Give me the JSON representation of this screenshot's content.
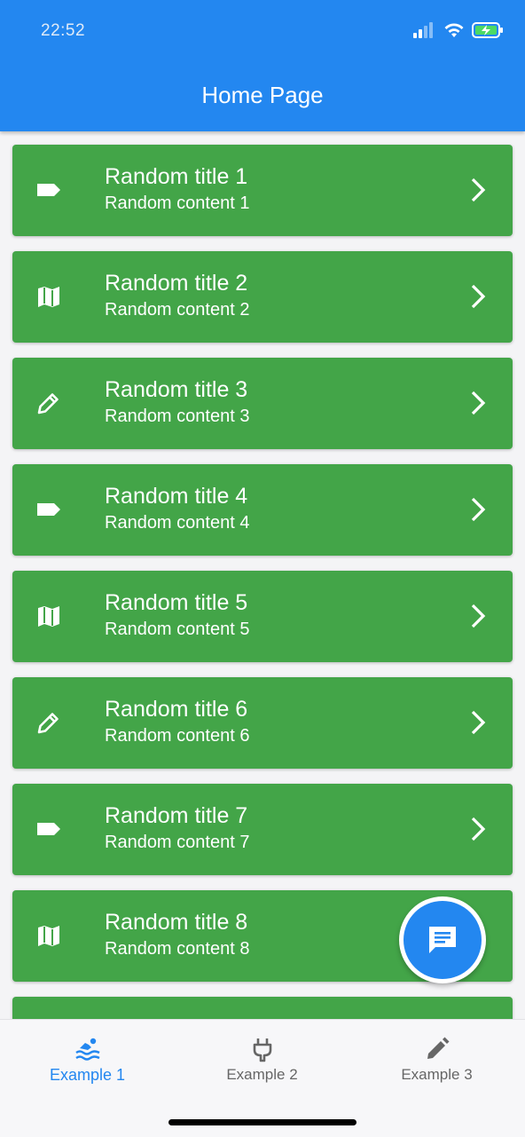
{
  "status_bar": {
    "time": "22:52"
  },
  "app_bar": {
    "title": "Home Page"
  },
  "items": [
    {
      "title": "Random title 1",
      "content": "Random content 1",
      "icon": "label-icon"
    },
    {
      "title": "Random title 2",
      "content": "Random content 2",
      "icon": "map-icon"
    },
    {
      "title": "Random title 3",
      "content": "Random content 3",
      "icon": "pencil-icon"
    },
    {
      "title": "Random title 4",
      "content": "Random content 4",
      "icon": "label-icon"
    },
    {
      "title": "Random title 5",
      "content": "Random content 5",
      "icon": "map-icon"
    },
    {
      "title": "Random title 6",
      "content": "Random content 6",
      "icon": "pencil-icon"
    },
    {
      "title": "Random title 7",
      "content": "Random content 7",
      "icon": "label-icon"
    },
    {
      "title": "Random title 8",
      "content": "Random content 8",
      "icon": "map-icon"
    }
  ],
  "fab": {
    "icon": "chat-icon"
  },
  "bottom_nav": [
    {
      "label": "Example 1",
      "icon": "swimming-icon",
      "active": true
    },
    {
      "label": "Example 2",
      "icon": "plug-icon",
      "active": false
    },
    {
      "label": "Example 3",
      "icon": "pencil-icon",
      "active": false
    }
  ],
  "colors": {
    "primary": "#2387f0",
    "card": "#43a548",
    "background": "#f4f4f6",
    "inactive_nav": "#666666"
  }
}
